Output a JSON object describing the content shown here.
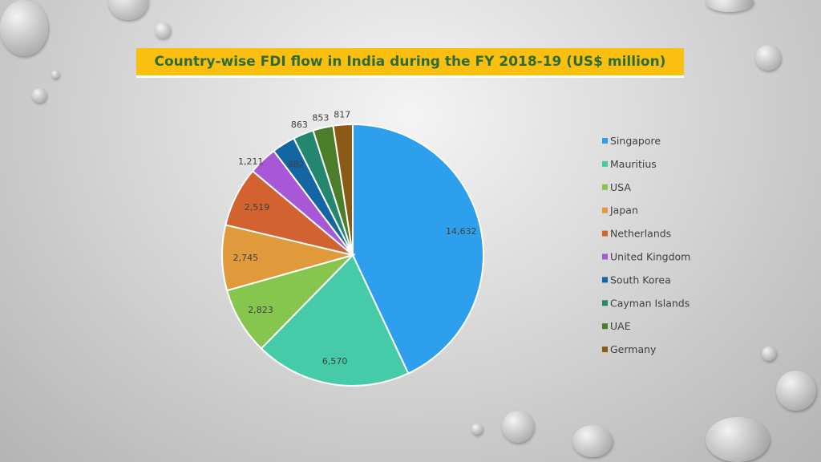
{
  "chart_data": {
    "type": "pie",
    "title": "Country-wise FDI flow in India during the FY 2018-19 (US$ million)",
    "categories": [
      "Singapore",
      "Mauritius",
      "USA",
      "Japan",
      "Netherlands",
      "United Kingdom",
      "South Korea",
      "Cayman Islands",
      "UAE",
      "Germany"
    ],
    "values": [
      14632,
      6570,
      2823,
      2745,
      2519,
      1211,
      982,
      863,
      853,
      817
    ],
    "labels": [
      "14,632",
      "6,570",
      "2,823",
      "2,745",
      "2,519",
      "1,211",
      "982",
      "863",
      "853",
      "817"
    ],
    "colors": [
      "#2e9fec",
      "#46cba8",
      "#86c64e",
      "#e09a3c",
      "#d2622f",
      "#a857d6",
      "#1465a4",
      "#22876e",
      "#4b7d2a",
      "#8a5a16"
    ],
    "legend": "right"
  }
}
